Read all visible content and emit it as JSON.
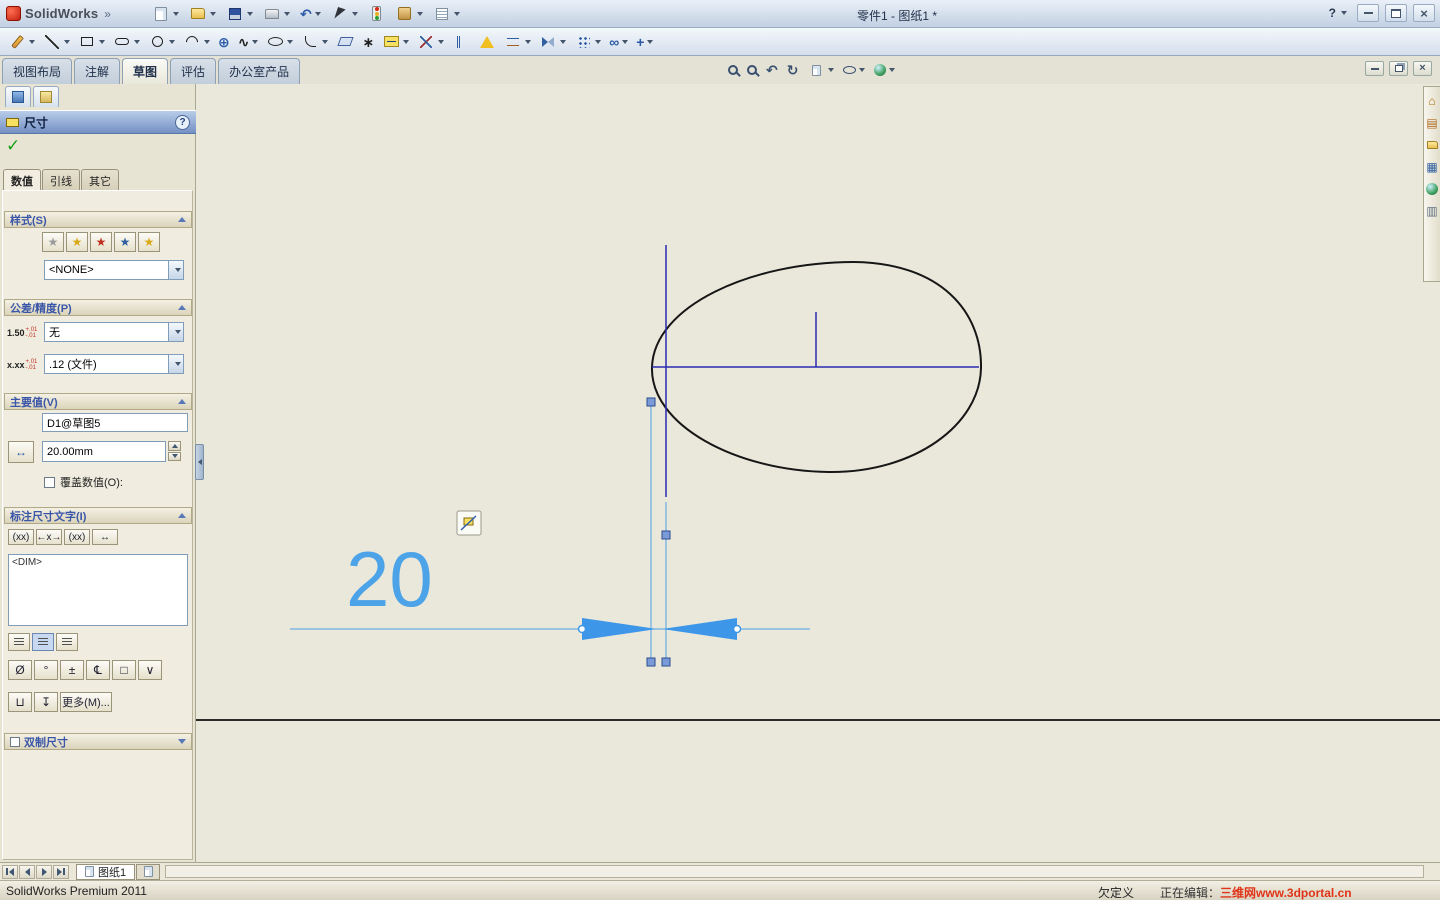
{
  "glyphs": {
    "menu_expand": "»",
    "undo": "↶",
    "spline": "∿",
    "perimeter_circle": "⊕",
    "point": "∗",
    "display_relations": "∞",
    "quick_snaps": "+",
    "previous_view": "↶",
    "rotate_view": "↻",
    "home": "⌂",
    "design_library": "▤",
    "view_palette": "▦",
    "custom_properties": "▥",
    "check": "✓",
    "star": "★",
    "close": "×",
    "value_arrows": "↔"
  },
  "titlebar": {
    "logo_text": "SolidWorks",
    "title": "零件1 - 图纸1 *",
    "help_label": "?",
    "icons": [
      "new-document",
      "open",
      "save",
      "print",
      "undo",
      "select",
      "rebuild",
      "options",
      "file-properties"
    ]
  },
  "sketch_toolbar": {
    "icons": [
      "sketch",
      "line",
      "rectangle",
      "slot",
      "circle",
      "arc",
      "perimeter-circle",
      "spline",
      "ellipse",
      "fillet",
      "plane",
      "point",
      "smart-dimension",
      "trim-entities",
      "convert-entities",
      "repair-sketch",
      "offset-entities",
      "mirror-entities",
      "linear-sketch-pattern",
      "display-delete-relations",
      "quick-snaps"
    ]
  },
  "command_tabs": {
    "items": [
      {
        "label": "视图布局"
      },
      {
        "label": "注解"
      },
      {
        "label": "草图"
      },
      {
        "label": "评估"
      },
      {
        "label": "办公室产品"
      }
    ],
    "active": "草图"
  },
  "viewbar": {
    "icons": [
      "zoom-fit",
      "zoom-to-area",
      "previous-view",
      "rotate-view",
      "view-settings",
      "hide-show-items",
      "appearances"
    ]
  },
  "taskpane": {
    "icons": [
      "solidworks-resources",
      "design-library",
      "file-explorer",
      "view-palette",
      "appearances",
      "custom-properties"
    ]
  },
  "property_panel": {
    "title": "尺寸",
    "help_label": "?",
    "tabs": [
      {
        "label": "数值"
      },
      {
        "label": "引线"
      },
      {
        "label": "其它"
      }
    ],
    "active_tab": "数值",
    "style_section": {
      "label": "样式(S)",
      "dropdown_value": "<NONE>"
    },
    "tolerance_section": {
      "label": "公差/精度(P)",
      "tolerance_icon": {
        "main": "1.50",
        "sup": "+.01",
        "sub": "-.01"
      },
      "tolerance_value": "无",
      "precision_icon": {
        "main": "x.xx",
        "sup": "+.01",
        "sub": "-.01"
      },
      "precision_value": ".12 (文件)"
    },
    "primary_section": {
      "label": "主要值(V)",
      "name_value": "D1@草图5",
      "dimension_value": "20.00mm",
      "override_label": "覆盖数值(O):"
    },
    "dim_text_section": {
      "label": "标注尺寸文字(I)",
      "position_buttons": [
        "(xx)",
        "←x→",
        "(xx)",
        "↔"
      ],
      "text_value": "<DIM>",
      "symbol_buttons": [
        "Ø",
        "°",
        "±",
        "℄",
        "□",
        "∨"
      ],
      "symbol_buttons2": [
        "⊔",
        "↧"
      ],
      "more_label": "更多(M)..."
    },
    "dual_section": {
      "label": "双制尺寸"
    }
  },
  "canvas": {
    "dimension_value": "20"
  },
  "sheet_bar": {
    "sheet_tab_label": "图纸1"
  },
  "status_bar": {
    "app_version": "SolidWorks Premium 2011",
    "definition_state": "欠定义",
    "editing_label": "正在编辑：",
    "watermark": "三维网www.3dportal.cn"
  }
}
